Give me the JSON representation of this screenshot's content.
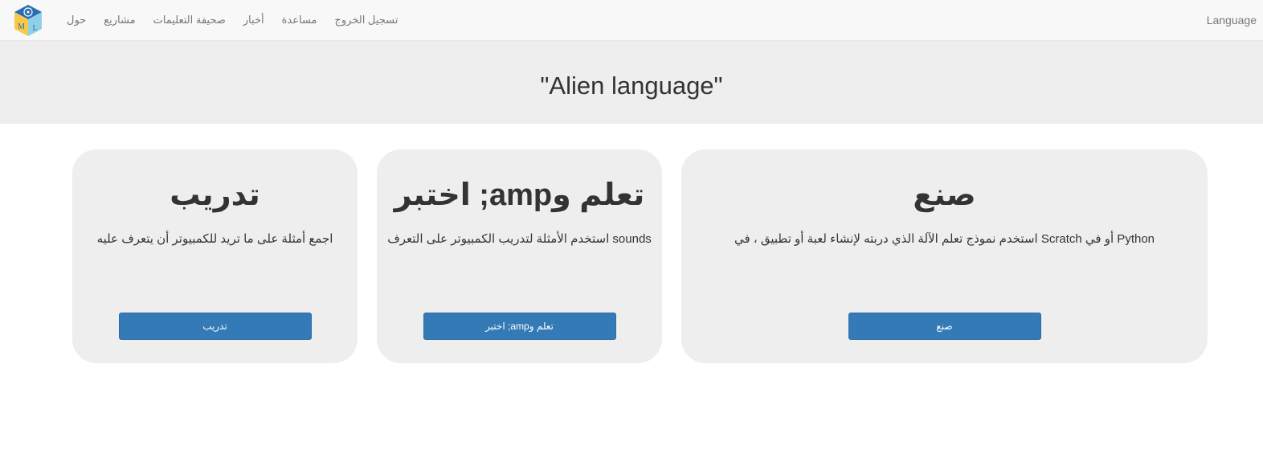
{
  "navbar": {
    "logo_letters": [
      "M",
      "L"
    ],
    "links": [
      "حول",
      "مشاريع",
      "صحيفة التعليمات",
      "أخبار",
      "مساعدة",
      "تسجيل الخروج"
    ],
    "language_label": "Language"
  },
  "header": {
    "title": "\"Alien language\""
  },
  "cards": {
    "train": {
      "title": "تدريب",
      "description": "اجمع أمثلة على ما تريد للكمبيوتر أن يتعرف عليه",
      "button": "تدريب"
    },
    "learn": {
      "title": "اختبر ;amp‏تعلم و",
      "description": "استخدم الأمثلة لتدريب الكمبيوتر على التعرف sounds",
      "button": "اختبر ;amp‏تعلم و"
    },
    "make": {
      "title": "صنع",
      "description": "استخدم نموذج تعلم الآلة الذي دربته لإنشاء لعبة أو تطبيق ، في Scratch أو في Python",
      "button": "صنع"
    }
  },
  "colors": {
    "navbar_bg": "#f8f8f8",
    "jumbotron_bg": "#eeeeee",
    "card_bg": "#eeeeee",
    "button_primary": "#337ab7"
  }
}
